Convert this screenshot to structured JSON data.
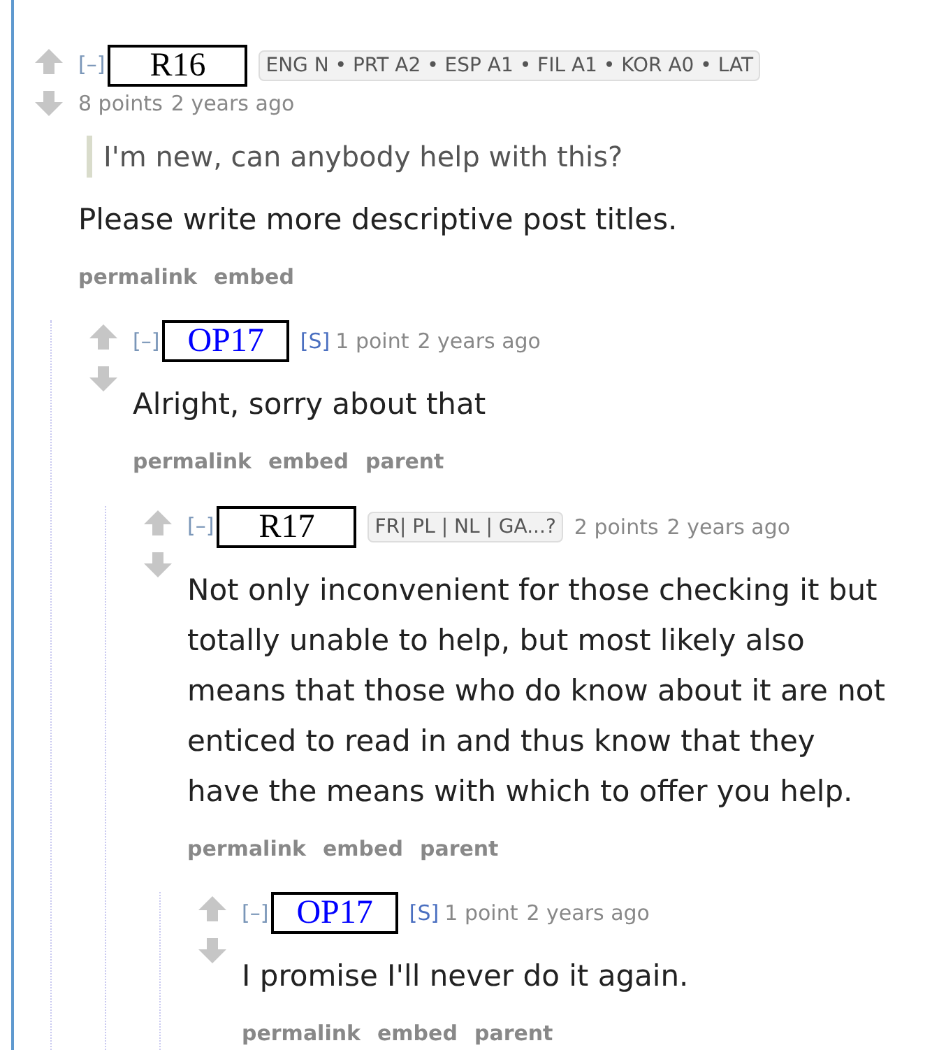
{
  "comments": [
    {
      "collapse": "[–]",
      "author": {
        "text": "R16",
        "kind": "user"
      },
      "flair": "ENG N • PRT A2 • ESP A1 • FIL A1 • KOR A0 • LAT",
      "score": "8 points",
      "time": "2 years ago",
      "quote": "I'm new, can anybody help with this?",
      "body": "Please write more descriptive post titles.",
      "links": [
        "permalink",
        "embed"
      ],
      "children": [
        {
          "collapse": "[–]",
          "author": {
            "text": "OP17",
            "kind": "op"
          },
          "tag": "[S]",
          "score": "1 point",
          "time": "2 years ago",
          "body": "Alright, sorry about that",
          "links": [
            "permalink",
            "embed",
            "parent"
          ],
          "children": [
            {
              "collapse": "[–]",
              "author": {
                "text": "R17",
                "kind": "user"
              },
              "flair": "FR| PL | NL | GA...?",
              "score": "2 points",
              "time": "2 years ago",
              "body": "Not only inconvenient for those checking it but totally unable to help, but most likely also means that those who do know about it are not enticed to read in and thus know that they have the means with which to offer you help.",
              "links": [
                "permalink",
                "embed",
                "parent"
              ],
              "children": [
                {
                  "collapse": "[–]",
                  "author": {
                    "text": "OP17",
                    "kind": "op"
                  },
                  "tag": "[S]",
                  "score": "1 point",
                  "time": "2 years ago",
                  "body": "I promise I'll never do it again.",
                  "links": [
                    "permalink",
                    "embed",
                    "parent"
                  ]
                }
              ]
            }
          ]
        }
      ]
    }
  ]
}
